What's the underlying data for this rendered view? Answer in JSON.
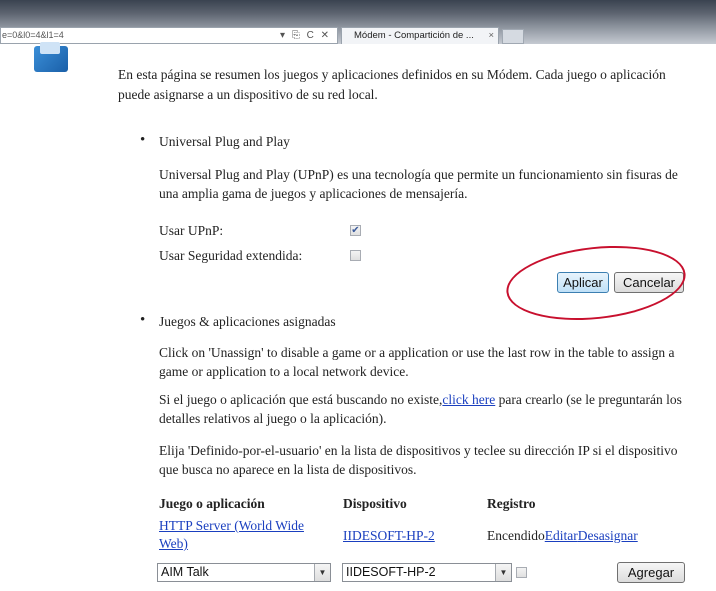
{
  "browser": {
    "address": "e=0&l0=4&l1=4",
    "address_icons": "▾ ⎘ C ✕",
    "tab_title": "Módem - Compartición de ...",
    "tab_close": "×"
  },
  "intro": "En esta página se resumen los juegos y aplicaciones definidos en su Módem. Cada juego o aplicación puede asignarse a un dispositivo de su red local.",
  "upnp": {
    "title": "Universal Plug and Play",
    "description": "Universal Plug and Play (UPnP) es una tecnología que permite un funcionamiento sin fisuras de una amplia gama de juegos y aplicaciones de mensajería.",
    "use_upnp_label": "Usar UPnP:",
    "use_upnp_checked": true,
    "extended_security_label": "Usar Seguridad extendida:",
    "extended_security_checked": false,
    "apply_button": "Aplicar",
    "cancel_button": "Cancelar"
  },
  "assigned": {
    "title": "Juegos & aplicaciones asignadas",
    "para1": "Click on 'Unassign' to disable a game or a application or use the last row in the table to assign a game or application to a local network device.",
    "para2_before": "Si el juego o aplicación que está buscando no existe,",
    "para2_link": "click here",
    "para2_after": " para crearlo (se le preguntarán los detalles relativos al juego o la aplicación).",
    "para3": "Elija 'Definido-por-el-usuario' en la lista de dispositivos y teclee su dirección IP si el dispositivo que busca no aparece en la lista de dispositivos."
  },
  "table": {
    "headers": [
      "Juego o aplicación",
      "Dispositivo",
      "Registro"
    ],
    "row": {
      "game": "HTTP Server (World Wide Web)",
      "device": "IIDESOFT-HP-2",
      "status": "Encendido",
      "edit_link": "Editar",
      "unassign_link": "Desasignar"
    },
    "new_row": {
      "game_select": "AIM Talk",
      "device_select": "IIDESOFT-HP-2",
      "log_checked": false,
      "add_button": "Agregar"
    }
  }
}
